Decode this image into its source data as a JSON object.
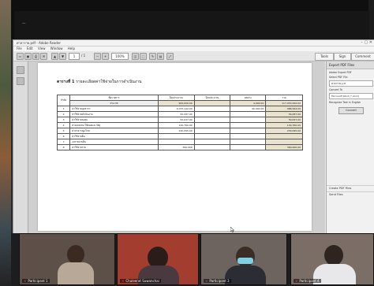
{
  "meeting": {
    "tag": "ㅡ"
  },
  "reader": {
    "title": "ศาลาราย.pdf - Adobe Reader",
    "menus": [
      "File",
      "Edit",
      "View",
      "Window",
      "Help"
    ],
    "page_current": "1",
    "page_total": "/ 1",
    "zoom": "100%",
    "tabs": [
      "Tools",
      "Sign",
      "Comment"
    ]
  },
  "document": {
    "heading_bold": "ตารางที่ 1",
    "heading_rest": "รายละเอียดค่าใช้จ่ายในการดำเนินงาน"
  },
  "table": {
    "col1": "ลำดับ",
    "col2a": "ชื่อรายการ",
    "col2b": "ประเภท",
    "col3": "ปีงบประมาณ",
    "col4": "ปีงบประมาณ",
    "col5": "ผลต่าง",
    "col6": "รวม",
    "totals": [
      "900,000.00",
      "",
      "4,000.00",
      "117,053,000.00"
    ],
    "rows": [
      {
        "no": "1",
        "name": "ค่าใช้จ่ายบุคลากร",
        "c3": "4,033,142.00",
        "c4": "",
        "c5": "40,000.00",
        "c6": "986,564.00"
      },
      {
        "no": "2",
        "name": "ค่าใช้จ่ายดำเนินงาน",
        "c3": "50,087.00",
        "c4": "",
        "c5": "",
        "c6": "56,087.00"
      },
      {
        "no": "3",
        "name": "ค่าใช้จ่ายลงทุน",
        "c3": "50,637.00",
        "c4": "",
        "c5": "",
        "c6": "50,637.00"
      },
      {
        "no": "4",
        "name": "ค่าตอบแทน ใช้สอยและวัสดุ",
        "c3": "140,760.00",
        "c4": "",
        "c5": "",
        "c6": "130,760.00"
      },
      {
        "no": "5",
        "name": "ค่าสาธารณูปโภค",
        "c3": "230,095.00",
        "c4": "",
        "c5": "",
        "c6": "230,095.00"
      },
      {
        "no": "6",
        "name": "ค่าใช้จ่ายอื่น",
        "c3": "",
        "c4": "",
        "c5": "",
        "c6": ""
      },
      {
        "no": "7",
        "name": "งบรายจ่ายอื่น",
        "c3": "",
        "c4": "",
        "c5": "",
        "c6": ""
      },
      {
        "no": "8",
        "name": "ค่าใช้จ่ายรวม",
        "c3": "360,000",
        "c4": "",
        "c5": "",
        "c6": "360,000.00"
      }
    ]
  },
  "right_pane": {
    "header": "Export PDF Files",
    "desc": "Adobe Export PDF",
    "file_label": "Select PDF File",
    "file_name": "ศาลาราย.pdf",
    "convert_label": "Convert To",
    "convert_value": "Microsoft Word (*.docx)",
    "recognize": "Recognize Text in English",
    "button": "Convert",
    "section2": "Create PDF Files",
    "section3": "Send Files"
  },
  "participants": [
    {
      "name": "Participant 1"
    },
    {
      "name": "Chuleerat Suwanchai"
    },
    {
      "name": "Participant 3"
    },
    {
      "name": "Participant 4"
    }
  ]
}
